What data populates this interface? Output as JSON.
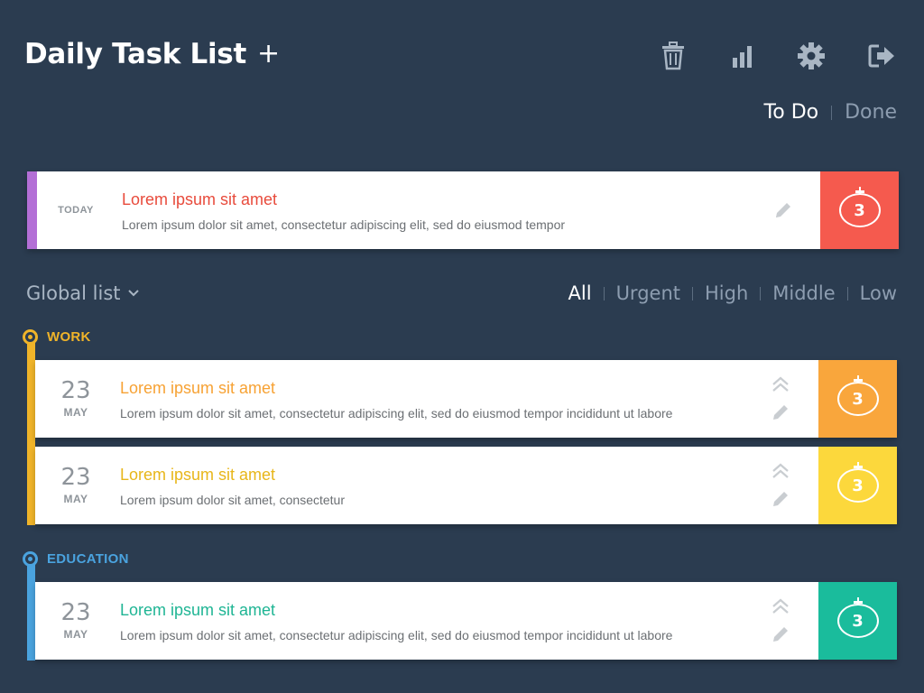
{
  "header": {
    "title": "Daily Task List",
    "add_label": "+",
    "icons": [
      "trash-icon",
      "stats-icon",
      "gear-icon",
      "logout-icon"
    ]
  },
  "view_tabs": {
    "todo": "To Do",
    "done": "Done",
    "active": "To Do"
  },
  "today_task": {
    "date_label": "TODAY",
    "title": "Lorem ipsum sit amet",
    "description": "Lorem ipsum dolor sit amet, consectetur adipiscing elit, sed do eiusmod tempor",
    "pomodoros": "3",
    "accent_color": "#b36fd6",
    "title_color": "#e84b3c",
    "pomo_color": "#f55a4e"
  },
  "list_selector": {
    "label": "Global list"
  },
  "filters": {
    "all": "All",
    "urgent": "Urgent",
    "high": "High",
    "middle": "Middle",
    "low": "Low",
    "active": "All"
  },
  "groups": [
    {
      "name": "WORK",
      "color": "#f0b429",
      "tasks": [
        {
          "day": "23",
          "month": "MAY",
          "title": "Lorem ipsum sit amet",
          "description": "Lorem ipsum dolor sit amet, consectetur adipiscing elit, sed do eiusmod tempor incididunt ut labore",
          "pomodoros": "3",
          "title_color": "#f7a234",
          "pomo_color": "#f9a63c"
        },
        {
          "day": "23",
          "month": "MAY",
          "title": "Lorem ipsum sit amet",
          "description": "Lorem ipsum dolor sit amet, consectetur",
          "pomodoros": "3",
          "title_color": "#e8b61a",
          "pomo_color": "#fcd83c"
        }
      ]
    },
    {
      "name": "EDUCATION",
      "color": "#4aa3df",
      "tasks": [
        {
          "day": "23",
          "month": "MAY",
          "title": "Lorem ipsum sit amet",
          "description": "Lorem ipsum dolor sit amet, consectetur adipiscing elit, sed do eiusmod tempor incididunt ut labore",
          "pomodoros": "3",
          "title_color": "#1fb594",
          "pomo_color": "#1abc9c"
        }
      ]
    }
  ]
}
